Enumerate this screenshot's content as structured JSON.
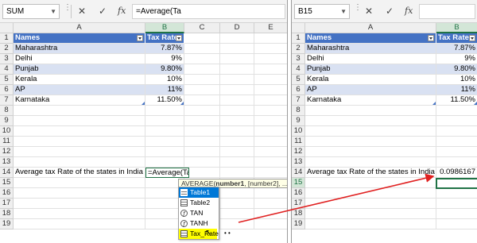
{
  "colors": {
    "table_header": "#4472c4",
    "table_band": "#d9e1f2",
    "selection_green": "#217346",
    "highlight_yellow": "#ffff00",
    "arrow_red": "#e02020"
  },
  "left": {
    "namebox": "SUM",
    "formula": "=Average(Ta",
    "columns": [
      "A",
      "B",
      "C",
      "D",
      "E"
    ],
    "rows": [
      "1",
      "2",
      "3",
      "4",
      "5",
      "6",
      "7",
      "8",
      "9",
      "10",
      "11",
      "12",
      "13",
      "14",
      "15",
      "16",
      "17",
      "18",
      "19"
    ],
    "table_header": {
      "names": "Names",
      "tax": "Tax Rate"
    },
    "table": [
      {
        "name": "Maharashtra",
        "rate": "7.87%"
      },
      {
        "name": "Delhi",
        "rate": "9%"
      },
      {
        "name": "Punjab",
        "rate": "9.80%"
      },
      {
        "name": "Kerala",
        "rate": "10%"
      },
      {
        "name": "AP",
        "rate": "11%"
      },
      {
        "name": "Karnataka",
        "rate": "11.50%"
      }
    ],
    "avg_label": "Average tax Rate of the states in India",
    "editing_text": "=Average(Ta",
    "tooltip": {
      "prefix": "AVERAGE(",
      "bold": "number1",
      "rest": ", [number2], ...)"
    },
    "autocomplete": [
      {
        "label": "Table1",
        "icon": "table-icon"
      },
      {
        "label": "Table2",
        "icon": "table-icon"
      },
      {
        "label": "TAN",
        "icon": "function-icon"
      },
      {
        "label": "TANH",
        "icon": "function-icon"
      },
      {
        "label": "Tax_Rate",
        "icon": "table-icon"
      }
    ]
  },
  "right": {
    "namebox": "B15",
    "formula": "",
    "columns": [
      "A",
      "B"
    ],
    "rows": [
      "1",
      "2",
      "3",
      "4",
      "5",
      "6",
      "7",
      "8",
      "9",
      "10",
      "11",
      "12",
      "13",
      "14",
      "15",
      "16",
      "17",
      "18",
      "19"
    ],
    "table_header": {
      "names": "Names",
      "tax": "Tax Rate"
    },
    "table": [
      {
        "name": "Maharashtra",
        "rate": "7.87%"
      },
      {
        "name": "Delhi",
        "rate": "9%"
      },
      {
        "name": "Punjab",
        "rate": "9.80%"
      },
      {
        "name": "Kerala",
        "rate": "10%"
      },
      {
        "name": "AP",
        "rate": "11%"
      },
      {
        "name": "Karnataka",
        "rate": "11.50%"
      }
    ],
    "avg_label": "Average tax Rate of the states in India",
    "avg_value": "0.0986167"
  },
  "formula_bar_icons": {
    "cancel": "✕",
    "enter": "✓",
    "fx": "fx",
    "dots": "⋮"
  }
}
